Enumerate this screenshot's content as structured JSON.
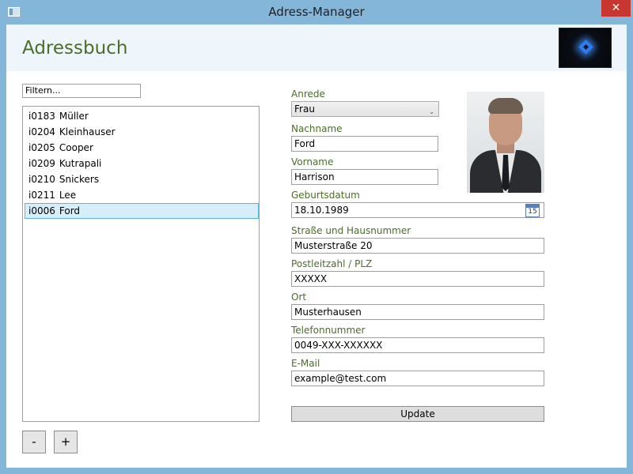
{
  "window": {
    "title": "Adress-Manager",
    "close_label": "✕"
  },
  "header": {
    "title": "Adressbuch"
  },
  "filter": {
    "value": "Filtern..."
  },
  "list": {
    "items": [
      {
        "id": "i0183",
        "name": "Müller",
        "selected": false
      },
      {
        "id": "i0204",
        "name": "Kleinhauser",
        "selected": false
      },
      {
        "id": "i0205",
        "name": "Cooper",
        "selected": false
      },
      {
        "id": "i0209",
        "name": "Kutrapali",
        "selected": false
      },
      {
        "id": "i0210",
        "name": "Snickers",
        "selected": false
      },
      {
        "id": "i0211",
        "name": "Lee",
        "selected": false
      },
      {
        "id": "i0006",
        "name": "Ford",
        "selected": true
      }
    ],
    "remove_label": "-",
    "add_label": "+"
  },
  "form": {
    "anrede": {
      "label": "Anrede",
      "value": "Frau"
    },
    "nachname": {
      "label": "Nachname",
      "value": "Ford"
    },
    "vorname": {
      "label": "Vorname",
      "value": "Harrison"
    },
    "geburtsdatum": {
      "label": "Geburtsdatum",
      "value": "18.10.1989",
      "calendar_day": "15"
    },
    "strasse": {
      "label": "Straße und Hausnummer",
      "value": "Musterstraße 20"
    },
    "plz": {
      "label": "Postleitzahl / PLZ",
      "value": "XXXXX"
    },
    "ort": {
      "label": "Ort",
      "value": "Musterhausen"
    },
    "telefon": {
      "label": "Telefonnummer",
      "value": "0049-XXX-XXXXXX"
    },
    "email": {
      "label": "E-Mail",
      "value": "example@test.com"
    },
    "update_label": "Update"
  },
  "colors": {
    "titlebar": "#83b6d9",
    "header_bg": "#eef6fc",
    "label_green": "#4b6e2a",
    "close_red": "#c7372f",
    "selection_bg": "#d5eefa",
    "selection_border": "#5fb4e0"
  }
}
